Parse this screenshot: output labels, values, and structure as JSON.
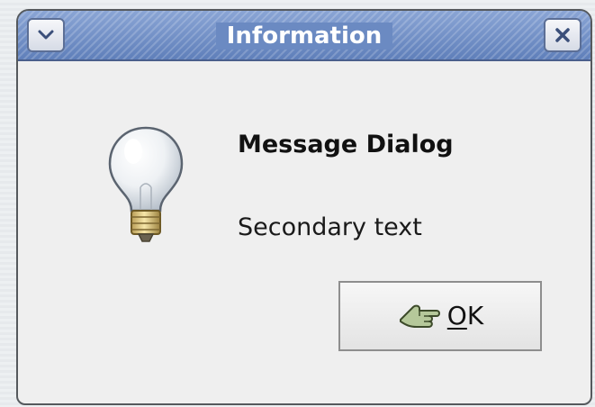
{
  "window": {
    "title": "Information",
    "titlebar_color": "#6b8ac2",
    "menu_icon": "chevron-down-icon",
    "close_icon": "close-icon"
  },
  "dialog": {
    "icon": "lightbulb-icon",
    "primary_text": "Message Dialog",
    "secondary_text": "Secondary text"
  },
  "ok_button": {
    "icon": "ok-hand-icon",
    "mnemonic": "O",
    "rest": "K"
  }
}
